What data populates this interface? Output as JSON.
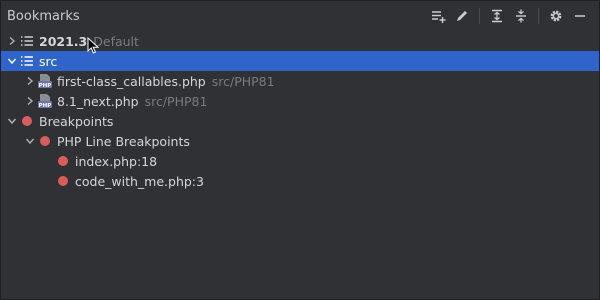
{
  "panel": {
    "title": "Bookmarks",
    "toolbar": {
      "icons": [
        "add-to-list-icon",
        "edit-icon",
        "expand-all-icon",
        "collapse-all-icon",
        "settings-gear-icon",
        "minimize-icon"
      ]
    }
  },
  "tree": {
    "group_default": {
      "label": "2021.3",
      "hint": "Default"
    },
    "group_src": {
      "label": "src"
    },
    "file1": {
      "label": "first-class_callables.php",
      "hint": "src/PHP81"
    },
    "file2": {
      "label": "8.1_next.php",
      "hint": "src/PHP81"
    },
    "breakpoints": {
      "label": "Breakpoints"
    },
    "php_line_breakpoints": {
      "label": "PHP Line Breakpoints"
    },
    "bp1": {
      "label": "index.php:18"
    },
    "bp2": {
      "label": "code_with_me.php:3"
    }
  },
  "colors": {
    "selection": "#2f65ca",
    "breakpoint": "#db5c5c",
    "background": "#2f3135"
  }
}
